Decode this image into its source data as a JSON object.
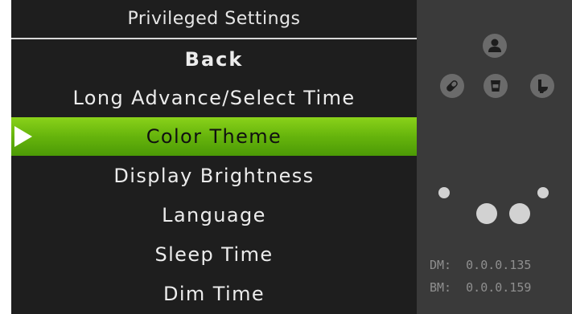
{
  "header": {
    "title": "Privileged Settings"
  },
  "menu": {
    "items": [
      {
        "label": "Back"
      },
      {
        "label": "Long Advance/Select Time"
      },
      {
        "label": "Color Theme"
      },
      {
        "label": "Display Brightness"
      },
      {
        "label": "Language"
      },
      {
        "label": "Sleep Time"
      },
      {
        "label": "Dim Time"
      }
    ],
    "selected_index": 2
  },
  "status": {
    "icons": [
      "person-icon",
      "pill-icon",
      "cup-icon",
      "toilet-icon"
    ],
    "dm_label": "DM:",
    "dm_value": "0.0.0.135",
    "bm_label": "BM:",
    "bm_value": "0.0.0.159"
  },
  "colors": {
    "selected_highlight": "#66b40c",
    "background": "#1e1e1e",
    "side_panel": "#3a3a3a"
  }
}
